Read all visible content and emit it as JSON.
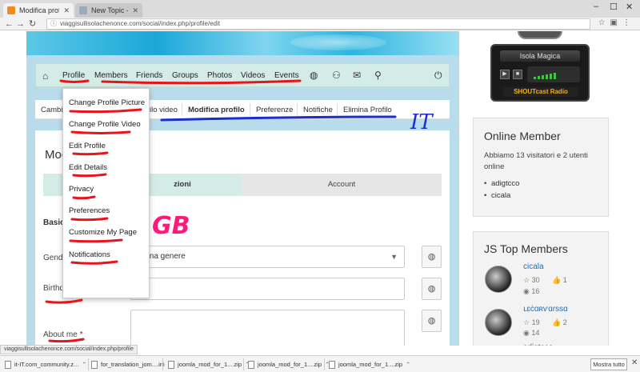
{
  "browser": {
    "tabs": [
      {
        "title": "Modifica profilo - viag...",
        "active": true
      },
      {
        "title": "New Topic - JomSocial",
        "active": false
      }
    ],
    "url": "viaggisullisolachenonce.com/social/index.php/profile/edit",
    "status_url": "viaggisullisolachenonce.com/social/index.php/profile"
  },
  "main_nav": {
    "items": [
      "Profile",
      "Members",
      "Friends",
      "Groups",
      "Photos",
      "Videos",
      "Events"
    ],
    "icons": [
      "home-icon",
      "globe-icon",
      "user-add-icon",
      "mail-icon",
      "search-icon",
      "power-icon"
    ]
  },
  "sub_nav": {
    "items": [
      "Cambi",
      "ilo video",
      "Modifica profilo",
      "Preferenze",
      "Notifiche",
      "Elimina Profilo"
    ],
    "active": "Modifica profilo"
  },
  "dropdown": {
    "items": [
      "Change Profile Picture",
      "Change Profile Video",
      "Edit Profile",
      "Edit Details",
      "Privacy",
      "Preferences",
      "Customize My Page",
      "Notifications"
    ]
  },
  "form": {
    "title": "Mod",
    "tabs": [
      "zioni",
      "Account"
    ],
    "section": "Basic",
    "gender_label": "Gende",
    "gender_value": "ziona genere",
    "birthdate_label": "Birthdate",
    "about_label": "About me",
    "required_mark": "*"
  },
  "annotations": {
    "it_label": "IT",
    "gb_label": "GB",
    "colors": {
      "red": "#e8141c",
      "blue": "#1a2ed0",
      "pink": "#ff1a7a"
    }
  },
  "radio": {
    "name": "Isola Magica",
    "logo": "SHOUTcast Radio",
    "play": "▶",
    "stop": "■"
  },
  "online_member": {
    "title": "Online Member",
    "text": "Abbiamo 13 visitatori e 2 utenti online",
    "users": [
      "adigtcco",
      "cicala"
    ]
  },
  "top_members": {
    "title": "JS Top Members",
    "members": [
      {
        "name": "cicala",
        "stars": "30",
        "likes": "1",
        "views": "16"
      },
      {
        "name": "ւɛċɑʀѵɑɾѕѕɑ",
        "stars": "19",
        "likes": "2",
        "views": "14"
      },
      {
        "name": "adigtcco"
      }
    ]
  },
  "downloads": {
    "items": [
      "it-IT.com_community.z...",
      "for_translation_jom....ini",
      "joomla_mod_for_1....zip",
      "joomla_mod_for_1....zip",
      "joomla_mod_for_1....zip"
    ],
    "show_all": "Mostra tutto"
  }
}
